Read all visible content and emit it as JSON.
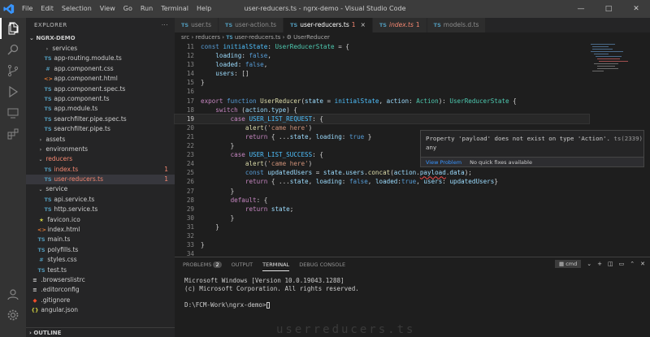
{
  "window": {
    "title": "user-reducers.ts - ngrx-demo - Visual Studio Code",
    "menu": [
      "File",
      "Edit",
      "Selection",
      "View",
      "Go",
      "Run",
      "Terminal",
      "Help"
    ]
  },
  "sidebar": {
    "header": "EXPLORER",
    "header_more": "···",
    "project": "NGRX-DEMO",
    "outline": "OUTLINE",
    "items": [
      {
        "label": "services",
        "type": "folder",
        "indent": 2,
        "icon": "chevron-right"
      },
      {
        "label": "app-routing.module.ts",
        "type": "ts",
        "indent": 2
      },
      {
        "label": "app.component.css",
        "type": "css",
        "indent": 2
      },
      {
        "label": "app.component.html",
        "type": "html",
        "indent": 2
      },
      {
        "label": "app.component.spec.ts",
        "type": "ts",
        "indent": 2
      },
      {
        "label": "app.component.ts",
        "type": "ts",
        "indent": 2
      },
      {
        "label": "app.module.ts",
        "type": "ts",
        "indent": 2
      },
      {
        "label": "searchfilter.pipe.spec.ts",
        "type": "ts",
        "indent": 2
      },
      {
        "label": "searchfilter.pipe.ts",
        "type": "ts",
        "indent": 2
      },
      {
        "label": "assets",
        "type": "folder",
        "indent": 1
      },
      {
        "label": "environments",
        "type": "folder",
        "indent": 1
      },
      {
        "label": "reducers",
        "type": "folder-open",
        "indent": 1,
        "error": true
      },
      {
        "label": "index.ts",
        "type": "ts",
        "indent": 2,
        "error": true,
        "badge": "1"
      },
      {
        "label": "user-reducers.ts",
        "type": "ts",
        "indent": 2,
        "error": true,
        "badge": "1",
        "selected": true
      },
      {
        "label": "service",
        "type": "folder-open",
        "indent": 1
      },
      {
        "label": "api.service.ts",
        "type": "ts",
        "indent": 2
      },
      {
        "label": "http.service.ts",
        "type": "ts",
        "indent": 2
      },
      {
        "label": "favicon.ico",
        "type": "star",
        "indent": 1
      },
      {
        "label": "index.html",
        "type": "html",
        "indent": 1
      },
      {
        "label": "main.ts",
        "type": "ts",
        "indent": 1
      },
      {
        "label": "polyfills.ts",
        "type": "ts",
        "indent": 1
      },
      {
        "label": "styles.css",
        "type": "css",
        "indent": 1
      },
      {
        "label": "test.ts",
        "type": "ts",
        "indent": 1
      },
      {
        "label": ".browserslistrc",
        "type": "config",
        "indent": 0
      },
      {
        "label": ".editorconfig",
        "type": "config",
        "indent": 0
      },
      {
        "label": ".gitignore",
        "type": "git",
        "indent": 0
      },
      {
        "label": "angular.json",
        "type": "json",
        "indent": 0
      }
    ]
  },
  "tabs": [
    {
      "label": "user.ts",
      "active": false
    },
    {
      "label": "user-action.ts",
      "active": false
    },
    {
      "label": "user-reducers.ts",
      "active": true,
      "badge": "1"
    },
    {
      "label": "index.ts",
      "active": false,
      "badge": "1",
      "error": true
    },
    {
      "label": "models.d.ts",
      "active": false
    }
  ],
  "tab_prefix": "TS",
  "breadcrumb": {
    "parts": [
      "src",
      "reducers",
      "user-reducers.ts",
      "UserReducer"
    ]
  },
  "code": {
    "current_line": 19,
    "lines": [
      {
        "n": 11,
        "text": "const initialState: UserReducerState = {"
      },
      {
        "n": 12,
        "text": "    loading: false,"
      },
      {
        "n": 13,
        "text": "    loaded: false,"
      },
      {
        "n": 14,
        "text": "    users: []"
      },
      {
        "n": 15,
        "text": "}"
      },
      {
        "n": 16,
        "text": ""
      },
      {
        "n": 17,
        "text": "export function UserReducer(state = initialState, action: Action): UserReducerState {"
      },
      {
        "n": 18,
        "text": "    switch (action.type) {"
      },
      {
        "n": 19,
        "text": "        case USER_LIST_REQUEST: {"
      },
      {
        "n": 20,
        "text": "            alert('came here')"
      },
      {
        "n": 21,
        "text": "            return { ...state, loading: true }"
      },
      {
        "n": 22,
        "text": "        }"
      },
      {
        "n": 23,
        "text": "        case USER_LIST_SUCCESS: {"
      },
      {
        "n": 24,
        "text": "            alert('came here')"
      },
      {
        "n": 25,
        "text": "            const updatedUsers = state.users.concat(action.payload.data);"
      },
      {
        "n": 26,
        "text": "            return { ...state, loading: false, loaded:true, users: updatedUsers}"
      },
      {
        "n": 27,
        "text": "        }"
      },
      {
        "n": 28,
        "text": "        default: {"
      },
      {
        "n": 29,
        "text": "            return state;"
      },
      {
        "n": 30,
        "text": "        }"
      },
      {
        "n": 31,
        "text": "    }"
      },
      {
        "n": 32,
        "text": ""
      },
      {
        "n": 33,
        "text": "}"
      },
      {
        "n": 34,
        "text": ""
      }
    ]
  },
  "hover": {
    "message": "Property 'payload' does not exist on type 'Action'.",
    "code": "ts(2339)",
    "source": "any",
    "view_problem": "View Problem",
    "no_fixes": "No quick fixes available"
  },
  "panel": {
    "tabs": [
      {
        "label": "PROBLEMS",
        "count": "2"
      },
      {
        "label": "OUTPUT"
      },
      {
        "label": "TERMINAL",
        "active": true
      },
      {
        "label": "DEBUG CONSOLE"
      }
    ],
    "shell": "cmd",
    "terminal_lines": [
      "Microsoft Windows [Version 10.0.19043.1288]",
      "(c) Microsoft Corporation. All rights reserved.",
      "",
      "D:\\FCM-Work\\ngrx-demo>"
    ]
  },
  "watermark": "userreducers.ts",
  "colors": {
    "accent": "#3794ff",
    "error": "#f48771",
    "ts_icon": "#519aba"
  }
}
